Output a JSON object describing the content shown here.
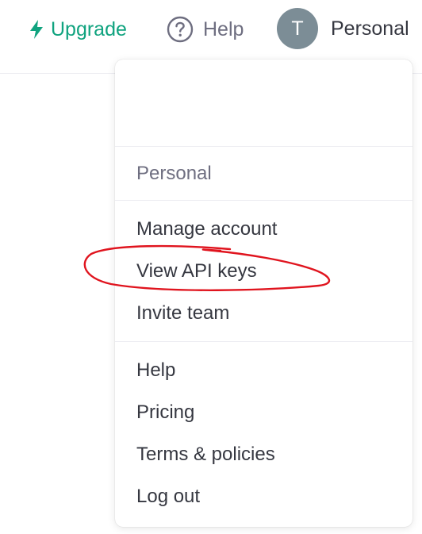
{
  "topbar": {
    "upgrade_label": "Upgrade",
    "help_label": "Help",
    "avatar_initial": "T",
    "account_label": "Personal"
  },
  "menu": {
    "section_label": "Personal",
    "group1": [
      "Manage account",
      "View API keys",
      "Invite team"
    ],
    "group2": [
      "Help",
      "Pricing",
      "Terms & policies",
      "Log out"
    ]
  },
  "colors": {
    "accent": "#10a37f",
    "annotation": "#e0141e",
    "avatar_bg": "#7c8d96",
    "text": "#353740",
    "muted": "#6e6e80"
  },
  "icons": {
    "upgrade": "lightning-bolt-icon",
    "help": "question-circle-icon"
  }
}
